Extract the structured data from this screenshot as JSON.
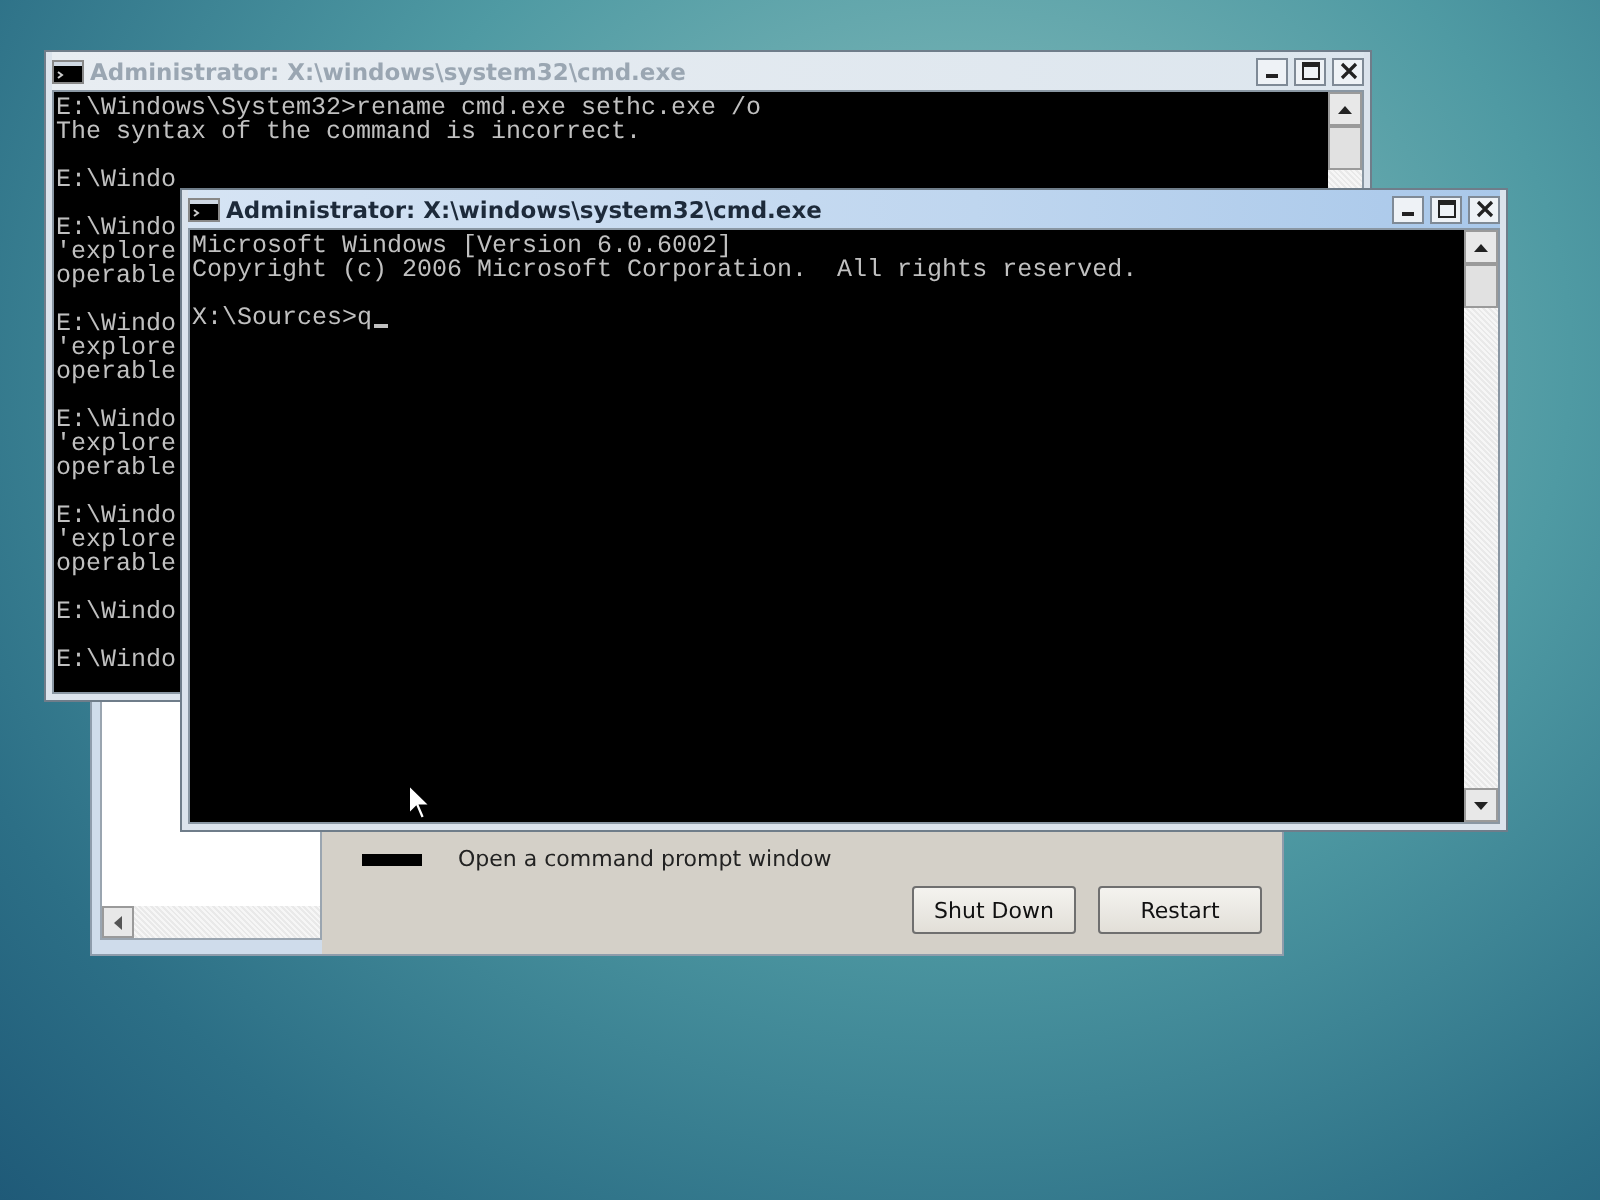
{
  "recovery_dialog": {
    "task_label": "Open a command prompt window",
    "buttons": [
      "Shut Down",
      "Restart"
    ]
  },
  "background_console": {
    "title": "Administrator: X:\\windows\\system32\\cmd.exe",
    "active": false,
    "blocks": [
      [
        "E:\\Windows\\System32>rename cmd.exe sethc.exe /o",
        "The syntax of the command is incorrect."
      ],
      [
        "E:\\Windo"
      ],
      [
        "E:\\Windo",
        "'explore",
        "operable"
      ],
      [
        "E:\\Windo",
        "'explore",
        "operable"
      ],
      [
        "E:\\Windo",
        "'explore",
        "operable"
      ],
      [
        "E:\\Windo",
        "'explore",
        "operable"
      ],
      [
        "E:\\Windo"
      ],
      [
        "E:\\Windo"
      ]
    ]
  },
  "foreground_console": {
    "title": "Administrator: X:\\windows\\system32\\cmd.exe",
    "active": true,
    "blocks": [
      [
        "Microsoft Windows [Version 6.0.6002]",
        "Copyright (c) 2006 Microsoft Corporation.  All rights reserved."
      ],
      [
        "X:\\Sources>q"
      ]
    ]
  }
}
